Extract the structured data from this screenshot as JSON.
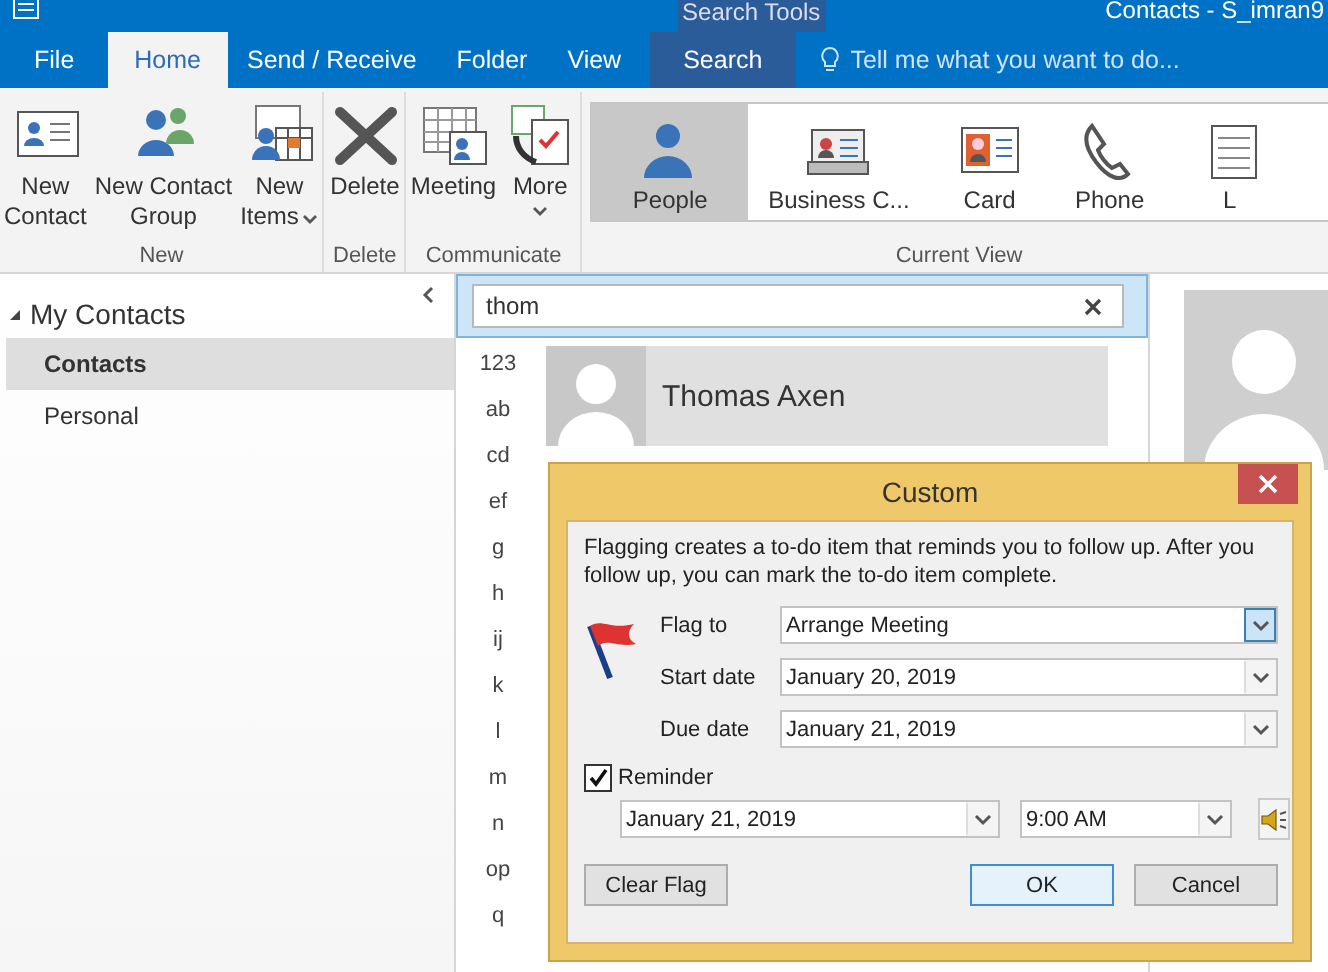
{
  "window": {
    "title": "Contacts - S_imran9",
    "contextual_group": "Search Tools"
  },
  "tabs": [
    {
      "label": "File",
      "selected": false,
      "kind": "normal"
    },
    {
      "label": "Home",
      "selected": true,
      "kind": "normal"
    },
    {
      "label": "Send / Receive",
      "selected": false,
      "kind": "normal"
    },
    {
      "label": "Folder",
      "selected": false,
      "kind": "normal"
    },
    {
      "label": "View",
      "selected": false,
      "kind": "normal"
    },
    {
      "label": "Search",
      "selected": false,
      "kind": "contextual"
    }
  ],
  "tell_me": {
    "placeholder": "Tell me what you want to do..."
  },
  "ribbon": {
    "groups": [
      {
        "label": "New",
        "buttons": [
          {
            "lines": [
              "New",
              "Contact"
            ],
            "dropdown": false
          },
          {
            "lines": [
              "New Contact",
              "Group"
            ],
            "dropdown": false
          },
          {
            "lines": [
              "New",
              "Items"
            ],
            "dropdown": true
          }
        ]
      },
      {
        "label": "Delete",
        "buttons": [
          {
            "lines": [
              "Delete"
            ],
            "dropdown": false
          }
        ]
      },
      {
        "label": "Communicate",
        "buttons": [
          {
            "lines": [
              "Meeting"
            ],
            "dropdown": false
          },
          {
            "lines": [
              "More"
            ],
            "dropdown": true
          }
        ]
      }
    ],
    "current_view": {
      "label": "Current View",
      "views": [
        {
          "label": "People",
          "selected": true
        },
        {
          "label": "Business C...",
          "selected": false
        },
        {
          "label": "Card",
          "selected": false
        },
        {
          "label": "Phone",
          "selected": false
        },
        {
          "label": "L",
          "selected": false
        }
      ]
    }
  },
  "sidebar": {
    "header": "My Contacts",
    "expanded": true,
    "items": [
      {
        "label": "Contacts",
        "selected": true
      },
      {
        "label": "Personal",
        "selected": false
      }
    ]
  },
  "search": {
    "value": "thom"
  },
  "index": [
    "123",
    "ab",
    "cd",
    "ef",
    "g",
    "h",
    "ij",
    "k",
    "l",
    "m",
    "n",
    "op",
    "q"
  ],
  "contacts": [
    {
      "name": "Thomas Axen"
    }
  ],
  "dialog": {
    "title": "Custom",
    "message": "Flagging creates a to-do item that reminds you to follow up. After you follow up, you can mark the to-do item complete.",
    "fields": [
      {
        "label": "Flag to",
        "value": "Arrange Meeting",
        "focused": true
      },
      {
        "label": "Start date",
        "value": "January 20, 2019",
        "focused": false
      },
      {
        "label": "Due date",
        "value": "January 21, 2019",
        "focused": false
      }
    ],
    "reminder": {
      "label": "Reminder",
      "checked": true,
      "date": "January 21, 2019",
      "time": "9:00 AM"
    },
    "buttons": [
      {
        "label": "Clear Flag",
        "default": false
      },
      {
        "label": "OK",
        "default": true
      },
      {
        "label": "Cancel",
        "default": false
      }
    ]
  }
}
